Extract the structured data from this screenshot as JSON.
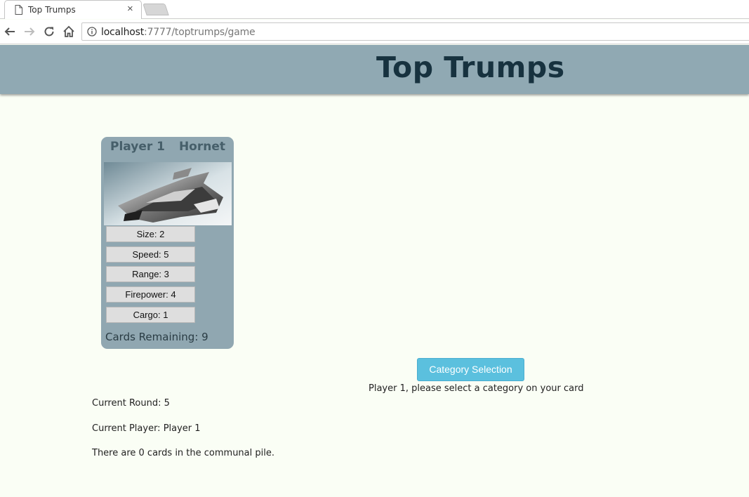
{
  "browser": {
    "tab_title": "Top Trumps",
    "tab_close": "×",
    "url_host": "localhost",
    "url_rest": ":7777/toptrumps/game"
  },
  "page": {
    "title": "Top Trumps",
    "card": {
      "player": "Player 1",
      "name": "Hornet",
      "stats": [
        {
          "label": "Size: 2"
        },
        {
          "label": "Speed: 5"
        },
        {
          "label": "Range: 3"
        },
        {
          "label": "Firepower: 4"
        },
        {
          "label": "Cargo: 1"
        }
      ],
      "cards_remaining": "Cards Remaining: 9"
    },
    "category_button": "Category Selection",
    "prompt": "Player 1, please select a category on your card",
    "current_round": "Current Round: 5",
    "current_player": "Current Player: Player 1",
    "communal_pile": "There are 0 cards in the communal pile."
  },
  "colors": {
    "header_bg": "#90a9b3",
    "title": "#17323f",
    "card_bg": "#90a7b1",
    "button": "#5bc0de",
    "page_bg": "#fafef5"
  },
  "icons": [
    "page-icon",
    "back-icon",
    "forward-icon",
    "reload-icon",
    "home-icon",
    "info-icon"
  ]
}
